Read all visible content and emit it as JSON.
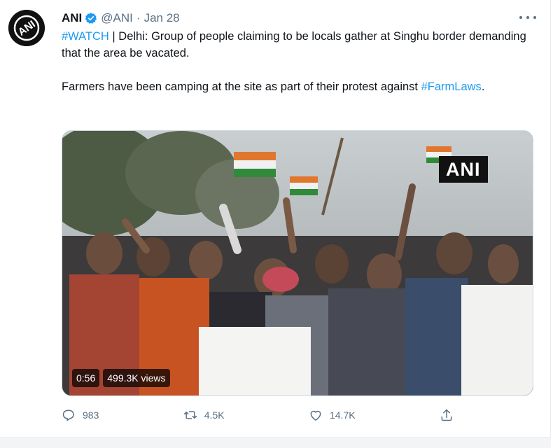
{
  "tweet": {
    "author_name": "ANI",
    "handle": "@ANI",
    "separator": "·",
    "date": "Jan 28",
    "line1_hashtag": "#WATCH",
    "line1_rest": " | Delhi: Group of people claiming to be locals gather at Singhu border demanding that the area be vacated.",
    "line2_text": "Farmers have been camping at the site as part of their protest against ",
    "line2_hashtag": "#FarmLaws",
    "line2_end": "."
  },
  "avatar": {
    "label": "ANI"
  },
  "media": {
    "watermark": "ANI",
    "duration": "0:56",
    "views": "499.3K views"
  },
  "actions": {
    "replies": "983",
    "retweets": "4.5K",
    "likes": "14.7K"
  },
  "icons": {
    "verified": "verified-badge-icon",
    "more": "more-options-icon",
    "reply": "reply-icon",
    "retweet": "retweet-icon",
    "like": "heart-icon",
    "share": "share-icon"
  },
  "colors": {
    "link": "#1d9bf0",
    "secondary": "#5b7083",
    "verified": "#1d9bf0"
  }
}
